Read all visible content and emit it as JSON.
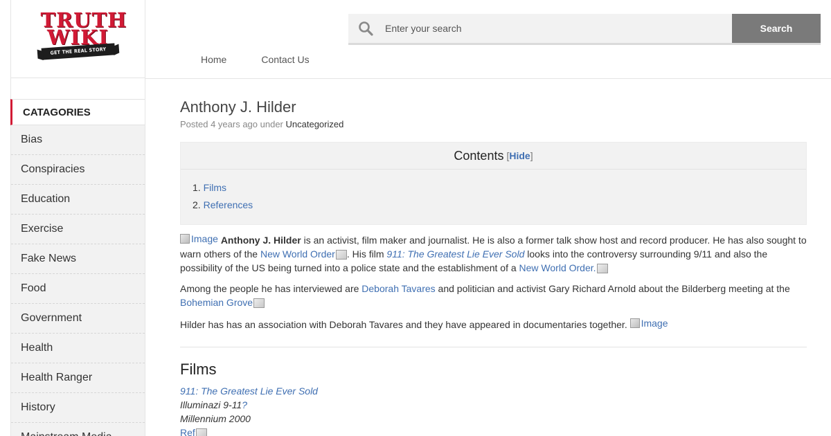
{
  "logo": {
    "line1": "TRUTH",
    "line2": "WIKI",
    "tagline": "GET THE REAL STORY"
  },
  "sidebar": {
    "heading": "CATAGORIES",
    "items": [
      "Bias",
      "Conspiracies",
      "Education",
      "Exercise",
      "Fake News",
      "Food",
      "Government",
      "Health",
      "Health Ranger",
      "History",
      "Mainstream Media"
    ]
  },
  "search": {
    "placeholder": "Enter your search",
    "button": "Search"
  },
  "nav": {
    "home": "Home",
    "contact": "Contact Us"
  },
  "article": {
    "title": "Anthony J. Hilder",
    "meta_posted": "Posted 4 years ago under",
    "meta_category": "Uncategorized",
    "toc": {
      "title": "Contents",
      "hide": "Hide",
      "items": [
        "Films",
        "References"
      ]
    },
    "image_alt": "Image",
    "p1": {
      "name": "Anthony J. Hilder",
      "t1": " is an activist, film maker and journalist. He is also a former talk show host and record producer. He has also sought to warn others of the ",
      "link1": "New World Order",
      "t2": ". His film ",
      "film_link": "911: The Greatest Lie Ever Sold",
      "t3": " looks into the controversy surrounding 9/11 and also the possibility of the US being turned into a police state and the establishment of a ",
      "link2": "New World Order."
    },
    "p2": {
      "t1": "Among the people he has interviewed are ",
      "link1": "Deborah Tavares",
      "t2": " and politician and activist Gary Richard Arnold about the Bilderberg meeting at the ",
      "link2": "Bohemian Grove"
    },
    "p3": {
      "t1": "Hilder has has an association with Deborah Tavares and they have appeared in documentaries together. "
    },
    "films": {
      "title": "Films",
      "film1": "911: The Greatest Lie Ever Sold",
      "film2": "Illuminazi 9-11",
      "film2_q": "?",
      "film3": "Millennium 2000",
      "ref": "Ref"
    }
  },
  "colors": {
    "brand_red": "#d11a35",
    "link": "#3f6fb2",
    "search_button": "#7a7a7a"
  }
}
